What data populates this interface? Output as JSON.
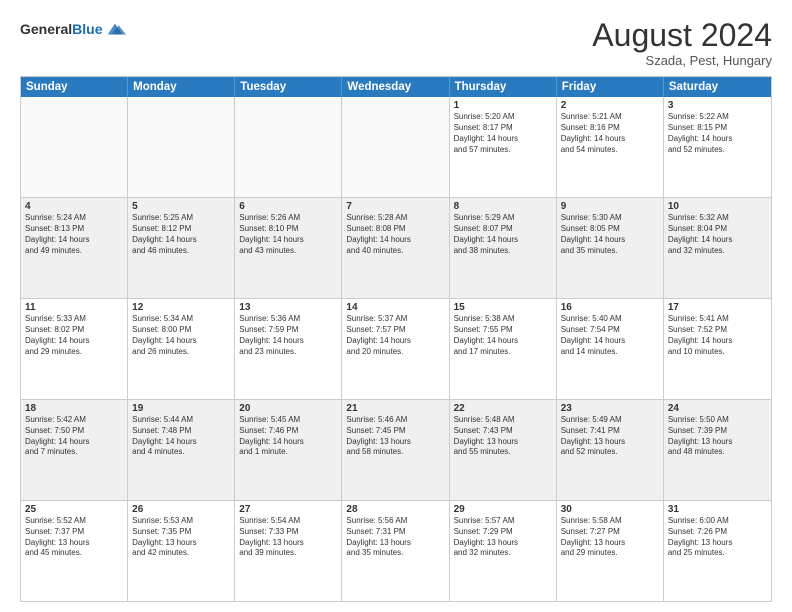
{
  "header": {
    "logo_general": "General",
    "logo_blue": "Blue",
    "month_title": "August 2024",
    "location": "Szada, Pest, Hungary"
  },
  "weekdays": [
    "Sunday",
    "Monday",
    "Tuesday",
    "Wednesday",
    "Thursday",
    "Friday",
    "Saturday"
  ],
  "rows": [
    [
      {
        "day": "",
        "text": "",
        "empty": true
      },
      {
        "day": "",
        "text": "",
        "empty": true
      },
      {
        "day": "",
        "text": "",
        "empty": true
      },
      {
        "day": "",
        "text": "",
        "empty": true
      },
      {
        "day": "1",
        "text": "Sunrise: 5:20 AM\nSunset: 8:17 PM\nDaylight: 14 hours\nand 57 minutes."
      },
      {
        "day": "2",
        "text": "Sunrise: 5:21 AM\nSunset: 8:16 PM\nDaylight: 14 hours\nand 54 minutes."
      },
      {
        "day": "3",
        "text": "Sunrise: 5:22 AM\nSunset: 8:15 PM\nDaylight: 14 hours\nand 52 minutes."
      }
    ],
    [
      {
        "day": "4",
        "text": "Sunrise: 5:24 AM\nSunset: 8:13 PM\nDaylight: 14 hours\nand 49 minutes."
      },
      {
        "day": "5",
        "text": "Sunrise: 5:25 AM\nSunset: 8:12 PM\nDaylight: 14 hours\nand 46 minutes."
      },
      {
        "day": "6",
        "text": "Sunrise: 5:26 AM\nSunset: 8:10 PM\nDaylight: 14 hours\nand 43 minutes."
      },
      {
        "day": "7",
        "text": "Sunrise: 5:28 AM\nSunset: 8:08 PM\nDaylight: 14 hours\nand 40 minutes."
      },
      {
        "day": "8",
        "text": "Sunrise: 5:29 AM\nSunset: 8:07 PM\nDaylight: 14 hours\nand 38 minutes."
      },
      {
        "day": "9",
        "text": "Sunrise: 5:30 AM\nSunset: 8:05 PM\nDaylight: 14 hours\nand 35 minutes."
      },
      {
        "day": "10",
        "text": "Sunrise: 5:32 AM\nSunset: 8:04 PM\nDaylight: 14 hours\nand 32 minutes."
      }
    ],
    [
      {
        "day": "11",
        "text": "Sunrise: 5:33 AM\nSunset: 8:02 PM\nDaylight: 14 hours\nand 29 minutes."
      },
      {
        "day": "12",
        "text": "Sunrise: 5:34 AM\nSunset: 8:00 PM\nDaylight: 14 hours\nand 26 minutes."
      },
      {
        "day": "13",
        "text": "Sunrise: 5:36 AM\nSunset: 7:59 PM\nDaylight: 14 hours\nand 23 minutes."
      },
      {
        "day": "14",
        "text": "Sunrise: 5:37 AM\nSunset: 7:57 PM\nDaylight: 14 hours\nand 20 minutes."
      },
      {
        "day": "15",
        "text": "Sunrise: 5:38 AM\nSunset: 7:55 PM\nDaylight: 14 hours\nand 17 minutes."
      },
      {
        "day": "16",
        "text": "Sunrise: 5:40 AM\nSunset: 7:54 PM\nDaylight: 14 hours\nand 14 minutes."
      },
      {
        "day": "17",
        "text": "Sunrise: 5:41 AM\nSunset: 7:52 PM\nDaylight: 14 hours\nand 10 minutes."
      }
    ],
    [
      {
        "day": "18",
        "text": "Sunrise: 5:42 AM\nSunset: 7:50 PM\nDaylight: 14 hours\nand 7 minutes."
      },
      {
        "day": "19",
        "text": "Sunrise: 5:44 AM\nSunset: 7:48 PM\nDaylight: 14 hours\nand 4 minutes."
      },
      {
        "day": "20",
        "text": "Sunrise: 5:45 AM\nSunset: 7:46 PM\nDaylight: 14 hours\nand 1 minute."
      },
      {
        "day": "21",
        "text": "Sunrise: 5:46 AM\nSunset: 7:45 PM\nDaylight: 13 hours\nand 58 minutes."
      },
      {
        "day": "22",
        "text": "Sunrise: 5:48 AM\nSunset: 7:43 PM\nDaylight: 13 hours\nand 55 minutes."
      },
      {
        "day": "23",
        "text": "Sunrise: 5:49 AM\nSunset: 7:41 PM\nDaylight: 13 hours\nand 52 minutes."
      },
      {
        "day": "24",
        "text": "Sunrise: 5:50 AM\nSunset: 7:39 PM\nDaylight: 13 hours\nand 48 minutes."
      }
    ],
    [
      {
        "day": "25",
        "text": "Sunrise: 5:52 AM\nSunset: 7:37 PM\nDaylight: 13 hours\nand 45 minutes."
      },
      {
        "day": "26",
        "text": "Sunrise: 5:53 AM\nSunset: 7:35 PM\nDaylight: 13 hours\nand 42 minutes."
      },
      {
        "day": "27",
        "text": "Sunrise: 5:54 AM\nSunset: 7:33 PM\nDaylight: 13 hours\nand 39 minutes."
      },
      {
        "day": "28",
        "text": "Sunrise: 5:56 AM\nSunset: 7:31 PM\nDaylight: 13 hours\nand 35 minutes."
      },
      {
        "day": "29",
        "text": "Sunrise: 5:57 AM\nSunset: 7:29 PM\nDaylight: 13 hours\nand 32 minutes."
      },
      {
        "day": "30",
        "text": "Sunrise: 5:58 AM\nSunset: 7:27 PM\nDaylight: 13 hours\nand 29 minutes."
      },
      {
        "day": "31",
        "text": "Sunrise: 6:00 AM\nSunset: 7:26 PM\nDaylight: 13 hours\nand 25 minutes."
      }
    ]
  ]
}
